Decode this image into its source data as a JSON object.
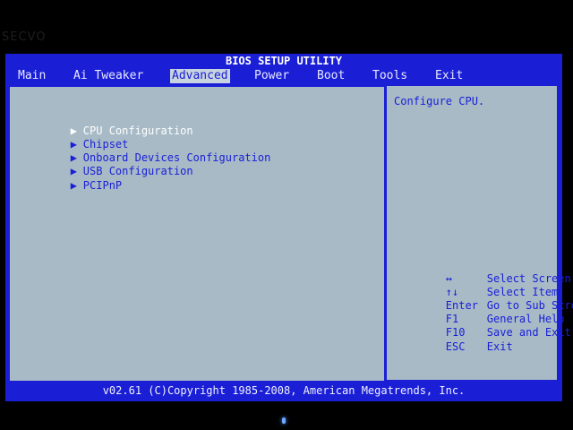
{
  "monitor": {
    "logo_text": "SECVO"
  },
  "title": "BIOS SETUP UTILITY",
  "menu": [
    {
      "label": "Main"
    },
    {
      "label": "Ai Tweaker"
    },
    {
      "label": "Advanced"
    },
    {
      "label": "Power"
    },
    {
      "label": "Boot"
    },
    {
      "label": "Tools"
    },
    {
      "label": "Exit"
    }
  ],
  "active_menu": "Advanced",
  "entries": [
    {
      "arrow": "▶",
      "label": "CPU Configuration"
    },
    {
      "arrow": "▶",
      "label": "Chipset"
    },
    {
      "arrow": "▶",
      "label": "Onboard Devices Configuration"
    },
    {
      "arrow": "▶",
      "label": "USB Configuration"
    },
    {
      "arrow": "▶",
      "label": "PCIPnP"
    }
  ],
  "help": {
    "text": "Configure CPU.",
    "keys": [
      {
        "key": "↔",
        "action": "Select Screen"
      },
      {
        "key": "↑↓",
        "action": "Select Item"
      },
      {
        "key": "Enter",
        "action": "Go to Sub Screen"
      },
      {
        "key": "F1",
        "action": "General Help"
      },
      {
        "key": "F10",
        "action": "Save and Exit"
      },
      {
        "key": "ESC",
        "action": "Exit"
      }
    ]
  },
  "footer": "v02.61 (C)Copyright 1985-2008, American Megatrends, Inc.",
  "colors": {
    "frame_blue": "#1a1fd6",
    "panel_gray": "#a7bac6",
    "text_blue": "#1a1fd6",
    "text_white": "#ffffff"
  }
}
